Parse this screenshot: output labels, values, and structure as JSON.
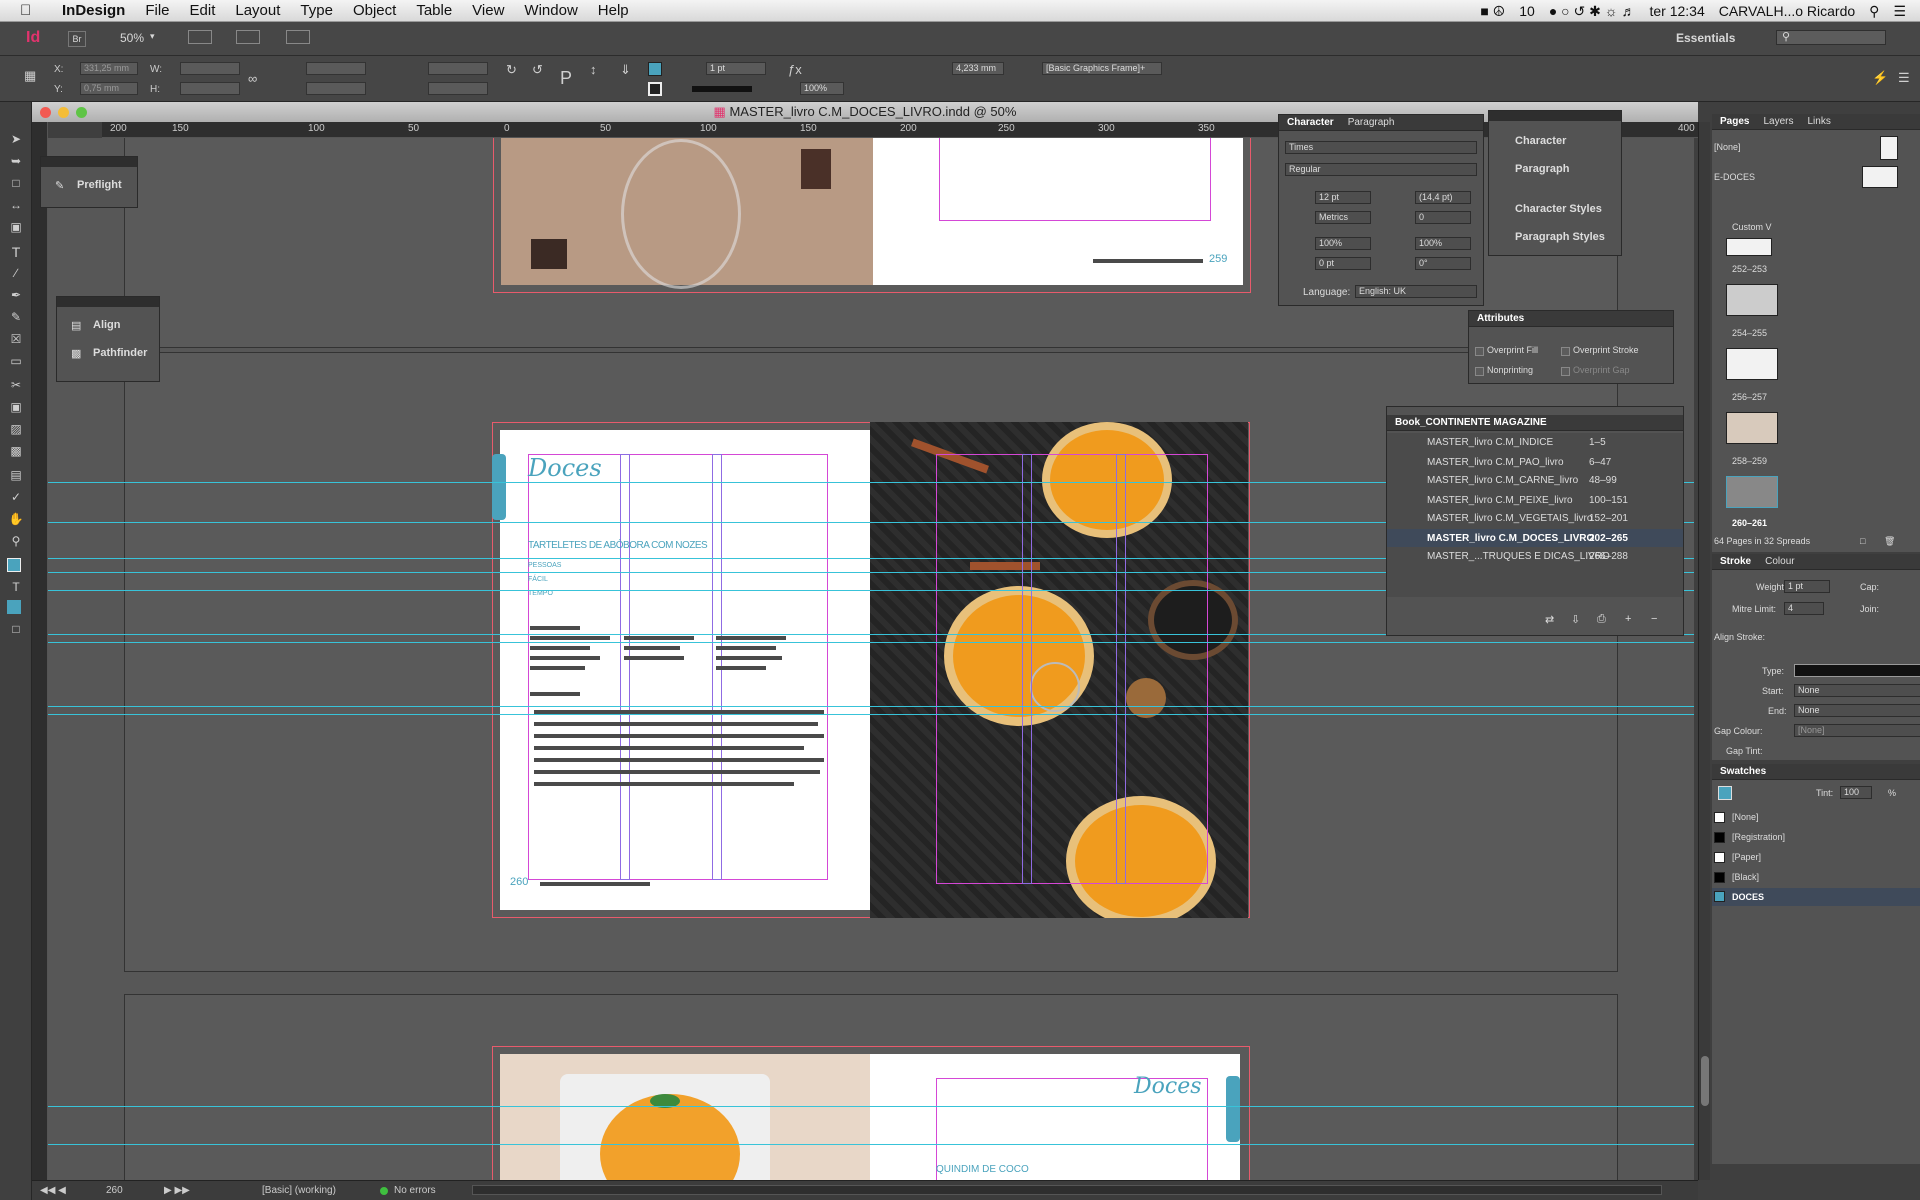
{
  "menubar": {
    "apple": "",
    "app": "InDesign",
    "items": [
      "File",
      "Edit",
      "Layout",
      "Type",
      "Object",
      "Table",
      "View",
      "Window",
      "Help"
    ],
    "status": {
      "battery": "10",
      "time": "ter 12:34",
      "user": "CARVALH...o Ricardo"
    }
  },
  "appbar": {
    "logo": "Id",
    "bridge": "Br",
    "zoom": "50%",
    "workspace": "Essentials"
  },
  "control": {
    "x_label": "X:",
    "x_value": "331,25 mm",
    "y_label": "Y:",
    "y_value": "0,75 mm",
    "w_label": "W:",
    "h_label": "H:",
    "stroke_weight": "1 pt",
    "scale": "100%",
    "ref": "4,233 mm",
    "frame_style": "[Basic Graphics Frame]+"
  },
  "document": {
    "title": "MASTER_livro C.M_DOCES_LIVRO.indd @ 50%",
    "ruler_labels": [
      "200",
      "150",
      "100",
      "50",
      "0",
      "50",
      "100",
      "150",
      "200",
      "250",
      "300",
      "350",
      "400"
    ],
    "folio_top": "259",
    "folio_mid": "260",
    "heading": "Doces",
    "recipe_title": "TARTELETES DE ABÓBORA COM NOZES",
    "meta": [
      "PESSOAS",
      "FÁCIL",
      "TEMPO"
    ],
    "bottom_heading": "Doces",
    "bottom_title": "QUINDIM DE COCO"
  },
  "panels": {
    "preflight": {
      "label": "Preflight"
    },
    "align": {
      "items": [
        "Align",
        "Pathfinder"
      ]
    },
    "character": {
      "tabs": [
        "Character",
        "Paragraph"
      ],
      "font": "Times",
      "style": "Regular",
      "size": "12 pt",
      "leading": "(14,4 pt)",
      "kerning": "Metrics",
      "tracking": "0",
      "vscale": "100%",
      "hscale": "100%",
      "baseline": "0 pt",
      "skew": "0°",
      "language_label": "Language:",
      "language": "English: UK"
    },
    "styles": {
      "items": [
        "Character",
        "Paragraph",
        "Character Styles",
        "Paragraph Styles"
      ]
    },
    "attributes": {
      "title": "Attributes",
      "overprint_fill": "Overprint Fill",
      "overprint_stroke": "Overprint Stroke",
      "nonprinting": "Nonprinting",
      "overprint_gap": "Overprint Gap"
    },
    "book": {
      "title": "Book_CONTINENTE MAGAZINE",
      "rows": [
        {
          "name": "MASTER_livro C.M_INDICE",
          "pages": "1–5"
        },
        {
          "name": "MASTER_livro C.M_PAO_livro",
          "pages": "6–47"
        },
        {
          "name": "MASTER_livro C.M_CARNE_livro",
          "pages": "48–99"
        },
        {
          "name": "MASTER_livro C.M_PEIXE_livro",
          "pages": "100–151"
        },
        {
          "name": "MASTER_livro C.M_VEGETAIS_livro",
          "pages": "152–201"
        },
        {
          "name": "MASTER_livro C.M_DOCES_LIVRO",
          "pages": "202–265"
        },
        {
          "name": "MASTER_...TRUQUES E DICAS_LIVRO",
          "pages": "266–288"
        }
      ]
    },
    "pages": {
      "tabs": [
        "Pages",
        "Layers",
        "Links"
      ],
      "masters": [
        "[None]",
        "E-DOCES"
      ],
      "custom": "Custom V",
      "spreads": [
        "252–253",
        "254–255",
        "256–257",
        "258–259",
        "260–261"
      ],
      "footer": "64 Pages in 32 Spreads"
    },
    "stroke": {
      "tabs": [
        "Stroke",
        "Colour"
      ],
      "weight_label": "Weight:",
      "weight": "1 pt",
      "cap_label": "Cap:",
      "mitre_label": "Mitre Limit:",
      "mitre": "4",
      "join_label": "Join:",
      "align_label": "Align Stroke:",
      "type_label": "Type:",
      "start_label": "Start:",
      "start": "None",
      "end_label": "End:",
      "end": "None",
      "gapcolour_label": "Gap Colour:",
      "gapcolour": "[None]",
      "gaptint_label": "Gap Tint:"
    },
    "swatches": {
      "title": "Swatches",
      "tint_label": "Tint:",
      "tint": "100",
      "pct": "%",
      "items": [
        {
          "name": "[None]",
          "color": "#ffffff"
        },
        {
          "name": "[Registration]",
          "color": "#000000"
        },
        {
          "name": "[Paper]",
          "color": "#ffffff"
        },
        {
          "name": "[Black]",
          "color": "#000000"
        },
        {
          "name": "DOCES",
          "color": "#4aa3bd"
        }
      ]
    }
  },
  "statusbar": {
    "page": "260",
    "master": "[Basic] (working)",
    "errors": "No errors"
  },
  "colors": {
    "accent": "#4aa3bd",
    "guide": "#38c3d9",
    "margin": "#d447d6",
    "bleed": "#e85b6c"
  }
}
